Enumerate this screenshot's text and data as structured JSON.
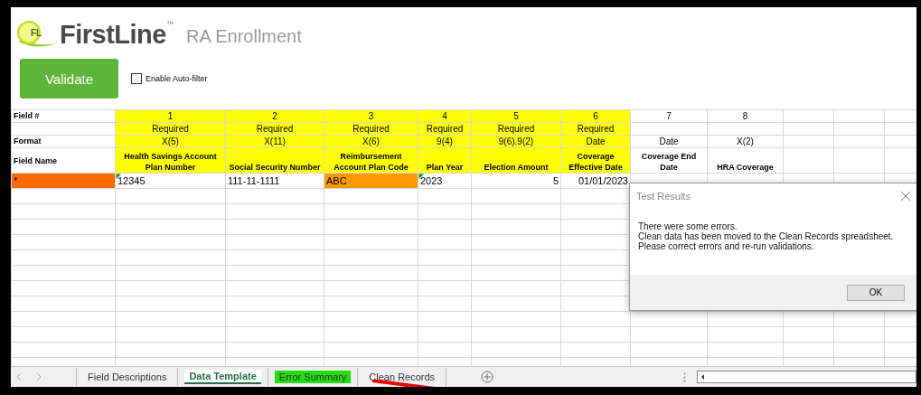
{
  "header": {
    "logo_mark": "FL",
    "brand": "FirstLine",
    "trademark": "™",
    "title": "RA Enrollment"
  },
  "validate_button": "Validate",
  "auto_filter": {
    "label": "Enable Auto-filter",
    "checked": false
  },
  "row_labels": {
    "number": "Field #",
    "format": "Format",
    "name": "Field Name"
  },
  "fields": [
    {
      "number": "1",
      "requirement": "Required",
      "format": "X(5)",
      "name": "Health Savings Account Plan Number",
      "highlighted": true
    },
    {
      "number": "2",
      "requirement": "Required",
      "format": "X(11)",
      "name": "Social Security Number",
      "highlighted": true
    },
    {
      "number": "3",
      "requirement": "Required",
      "format": "X(6)",
      "name": "Reimbursement Account Plan Code",
      "highlighted": true
    },
    {
      "number": "4",
      "requirement": "Required",
      "format": "9(4)",
      "name": "Plan Year",
      "highlighted": true
    },
    {
      "number": "5",
      "requirement": "Required",
      "format": "9(6).9(2)",
      "name": "Election Amount",
      "highlighted": true
    },
    {
      "number": "6",
      "requirement": "Required",
      "format": "Date",
      "name": "Coverage Effective Date",
      "highlighted": true
    },
    {
      "number": "7",
      "format": "Date",
      "name": "Coverage End Date",
      "highlighted": false
    },
    {
      "number": "8",
      "format": "X(2)",
      "name": "HRA Coverage",
      "highlighted": false
    }
  ],
  "data_row": [
    {
      "text": "*",
      "kind": "text",
      "color": "#ff6a00",
      "flagged": false
    },
    {
      "text": "12345",
      "kind": "text",
      "flagged": true
    },
    {
      "text": "111-11-1111",
      "kind": "text",
      "flagged": false
    },
    {
      "text": "ABC",
      "kind": "text",
      "color": "#ff9900",
      "flagged": false
    },
    {
      "text": "2023",
      "kind": "text",
      "flagged": true
    },
    {
      "text": "5",
      "kind": "number",
      "flagged": false
    },
    {
      "text": "01/01/2023",
      "kind": "number",
      "flagged": false
    }
  ],
  "dialog": {
    "title": "Test Results",
    "lines": [
      "There were some errors.",
      "Clean data has been moved to the Clean Records spreadsheet.",
      "Please correct errors and re-run validations."
    ],
    "button": "OK"
  },
  "sheet_tabs": [
    {
      "label": "Field Descriptions",
      "selected": false
    },
    {
      "label": "Data Template",
      "selected": true
    },
    {
      "label": "Error Summary",
      "selected": false,
      "color": "#22dd11"
    },
    {
      "label": "Clean Records",
      "selected": false
    }
  ]
}
